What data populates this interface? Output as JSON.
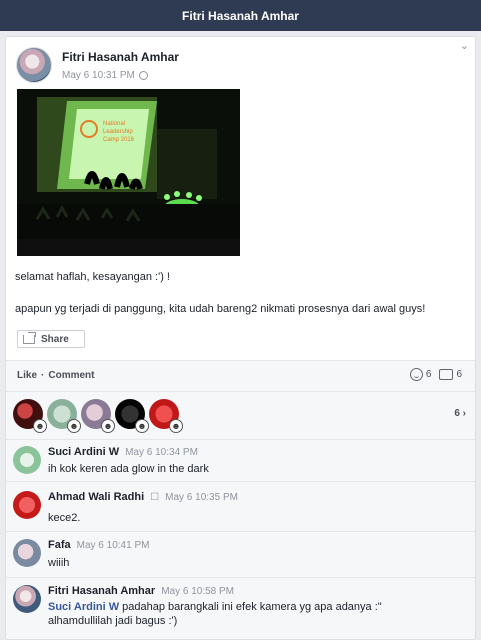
{
  "header": {
    "title": "Fitri Hasanah Amhar"
  },
  "post": {
    "author": "Fitri Hasanah Amhar",
    "time": "May 6 10:31 PM",
    "caption_line1": "selamat haflah, kesayangan :') !",
    "caption_line2": "apapun yg terjadi di panggung, kita udah bareng2 nikmati prosesnya dari awal guys!",
    "share_label": "Share",
    "photo_screen_text": "National Leadership Camp 2016"
  },
  "actions": {
    "like": "Like",
    "dot": "·",
    "comment": "Comment",
    "reactions_count": "6",
    "comments_count": "6"
  },
  "likers": {
    "count": "6 ›"
  },
  "comments": [
    {
      "name": "Suci Ardini W",
      "time": "May 6 10:34 PM",
      "text": "ih kok keren ada glow in the dark"
    },
    {
      "name": "Ahmad Wali Radhi",
      "badge": "☐",
      "time": "May 6 10:35 PM",
      "text": "kece2."
    },
    {
      "name": "Fafa",
      "time": "May 6 10:41 PM",
      "text": "wiiih"
    },
    {
      "name": "Fitri Hasanah Amhar",
      "time": "May 6 10:58 PM",
      "tag": "Suci Ardini W",
      "text": "padahap barangkali ini efek kamera yg apa adanya :\"",
      "text2": " alhamdullilah jadi bagus :')"
    }
  ],
  "icons": {
    "globe": "globe-icon",
    "share": "share-icon",
    "reaction": "smile-icon",
    "comment": "comment-icon",
    "chevron": "chevron-down-icon"
  }
}
